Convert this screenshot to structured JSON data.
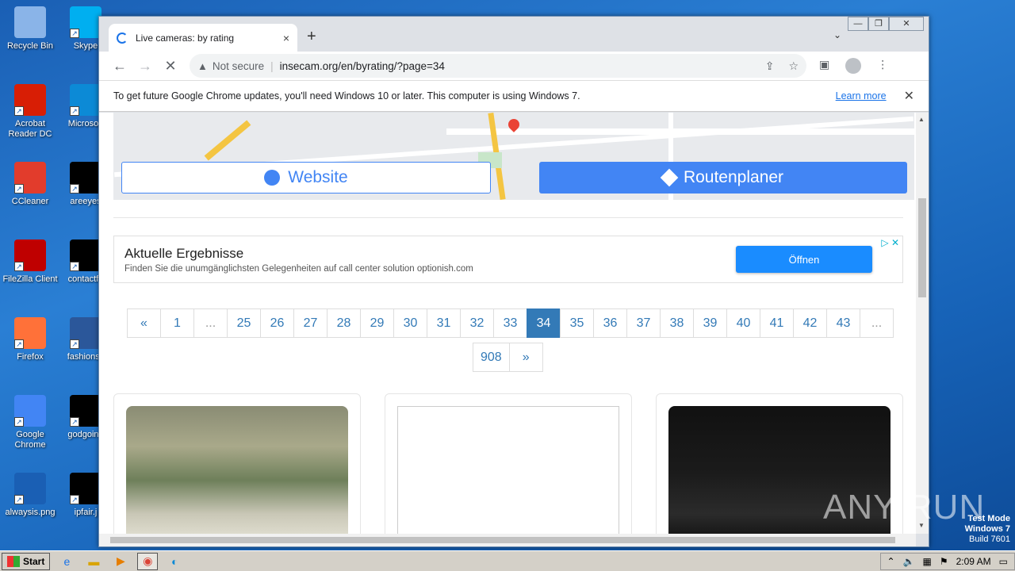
{
  "desktop": {
    "icons": [
      {
        "label": "Recycle Bin",
        "icon": "recycle-bin-icon",
        "color": "#8ab4e8"
      },
      {
        "label": "Skype",
        "icon": "skype-icon",
        "color": "#00aff0"
      },
      {
        "label": "Acrobat Reader DC",
        "icon": "acrobat-icon",
        "color": "#d81e05"
      },
      {
        "label": "Microsoft",
        "icon": "edge-icon",
        "color": "#0c8ad6"
      },
      {
        "label": "CCleaner",
        "icon": "ccleaner-icon",
        "color": "#e23c2c"
      },
      {
        "label": "areeyes",
        "icon": "file-icon",
        "color": "#000000"
      },
      {
        "label": "FileZilla Client",
        "icon": "filezilla-icon",
        "color": "#bf0000"
      },
      {
        "label": "contactfri",
        "icon": "file-icon",
        "color": "#000000"
      },
      {
        "label": "Firefox",
        "icon": "firefox-icon",
        "color": "#ff7139"
      },
      {
        "label": "fashionsy",
        "icon": "word-doc-icon",
        "color": "#2b579a"
      },
      {
        "label": "Google Chrome",
        "icon": "chrome-icon",
        "color": "#4285f4"
      },
      {
        "label": "godgoing",
        "icon": "file-icon",
        "color": "#000000"
      },
      {
        "label": "alwaysis.png",
        "icon": "image-file-icon",
        "color": "#1a5fb4"
      },
      {
        "label": "ipfair.j",
        "icon": "file-icon",
        "color": "#000000"
      }
    ]
  },
  "browser": {
    "tab_title": "Live cameras: by rating",
    "tab_close": "×",
    "new_tab": "+",
    "address": {
      "security": "Not secure",
      "url": "insecam.org/en/byrating/?page=34"
    },
    "infobar": {
      "message": "To get future Google Chrome updates, you'll need Windows 10 or later. This computer is using Windows 7.",
      "link": "Learn more",
      "close": "✕"
    }
  },
  "page": {
    "map_buttons": {
      "website": "Website",
      "route": "Routenplaner"
    },
    "ad": {
      "title": "Aktuelle Ergebnisse",
      "description": "Finden Sie die unumgänglichsten Gelegenheiten auf call center solution optionish.com",
      "cta": "Öffnen"
    },
    "pagination": {
      "row1": [
        "«",
        "1",
        "...",
        "25",
        "26",
        "27",
        "28",
        "29",
        "30",
        "31",
        "32",
        "33",
        "34",
        "35",
        "36",
        "37",
        "38",
        "39",
        "40",
        "41",
        "42",
        "43",
        "..."
      ],
      "row2": [
        "908",
        "»"
      ],
      "active": "34"
    },
    "cameras": [
      {
        "name": "camera-thumbnail-1"
      },
      {
        "name": "camera-thumbnail-2"
      },
      {
        "name": "camera-thumbnail-3"
      }
    ]
  },
  "watermark": {
    "text": "ANY RUN"
  },
  "system": {
    "test_mode": "Test Mode",
    "os": "Windows 7",
    "build": "Build 7601",
    "start": "Start",
    "clock": "2:09 AM"
  }
}
